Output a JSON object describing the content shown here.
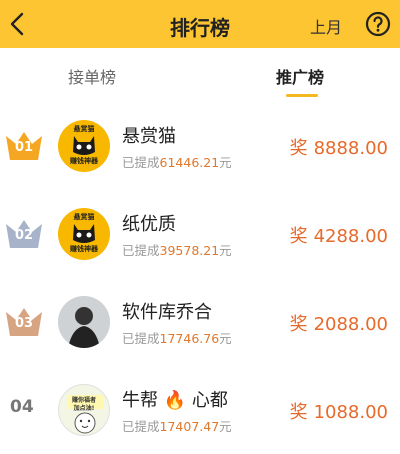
{
  "header": {
    "title": "排行榜",
    "month_label": "上月",
    "back_icon": "chevron-left-icon",
    "help_icon": "help-circle-icon"
  },
  "tabs": [
    {
      "label": "接单榜",
      "active": false
    },
    {
      "label": "推广榜",
      "active": true
    }
  ],
  "colors": {
    "header_bg": "#fcc531",
    "accent": "#e86a2a",
    "gold": "#f5a623",
    "silver": "#a7b3c9",
    "bronze": "#d7a482"
  },
  "leaderboard": [
    {
      "rank": "01",
      "name": "悬赏猫",
      "sub_prefix": "已提成",
      "amount": "61446.21",
      "unit": "元",
      "reward_label": "奖",
      "reward": "8888.00",
      "avatar_top": "悬赏猫",
      "avatar_bottom": "赚钱神器"
    },
    {
      "rank": "02",
      "name": "纸优质",
      "sub_prefix": "已提成",
      "amount": "39578.21",
      "unit": "元",
      "reward_label": "奖",
      "reward": "4288.00",
      "avatar_top": "悬赏猫",
      "avatar_bottom": "赚钱神器"
    },
    {
      "rank": "03",
      "name": "软件库乔合",
      "sub_prefix": "已提成",
      "amount": "17746.76",
      "unit": "元",
      "reward_label": "奖",
      "reward": "2088.00"
    },
    {
      "rank": "04",
      "name_part1": "牛帮",
      "name_part2": "心都",
      "name_emoji": "🔥",
      "sub_prefix": "已提成",
      "amount": "17407.47",
      "unit": "元",
      "reward_label": "奖",
      "reward": "1088.00",
      "avatar_text1": "赚你福者",
      "avatar_text2": "加点油!"
    }
  ]
}
